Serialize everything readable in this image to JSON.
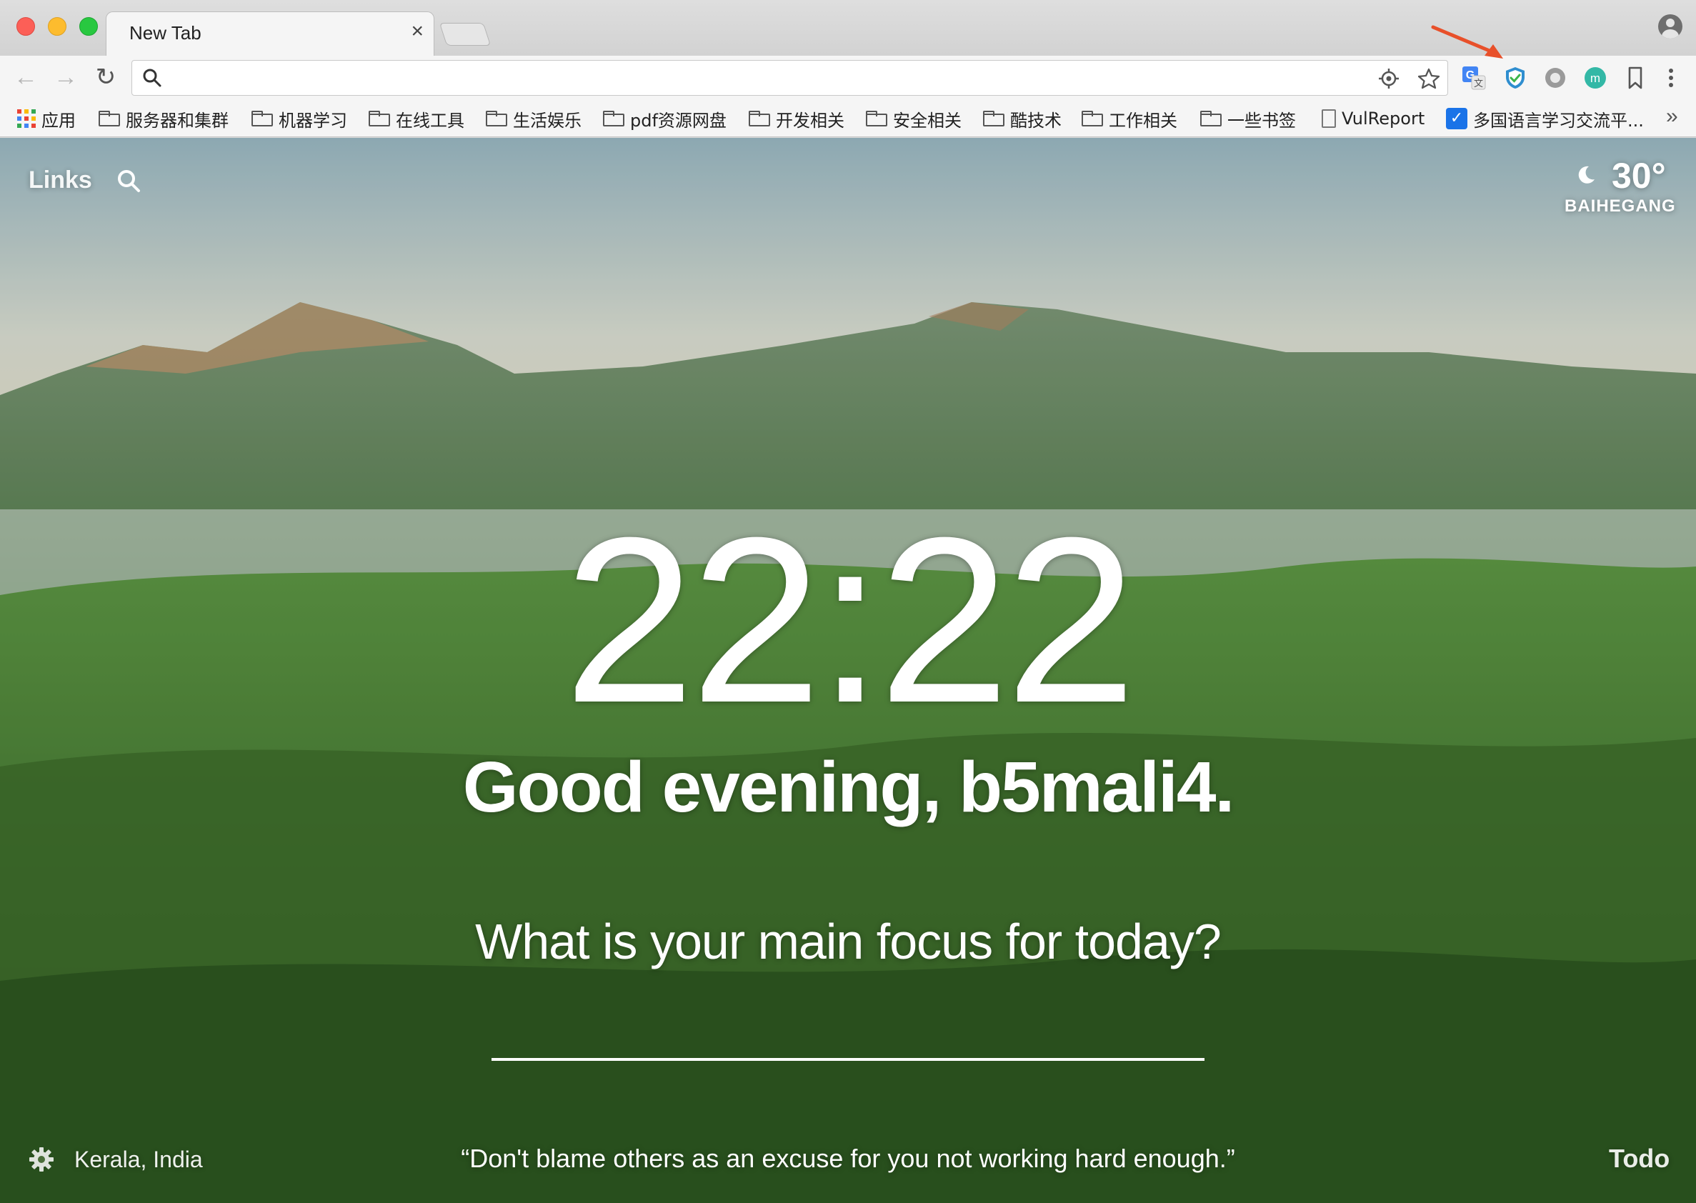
{
  "tab": {
    "title": "New Tab",
    "close": "×"
  },
  "toolbar": {
    "back": "←",
    "forward": "→",
    "reload": "↻",
    "omnibox_value": ""
  },
  "bookmarks": [
    {
      "label": "应用",
      "icon": "apps-icon"
    },
    {
      "label": "服务器和集群",
      "icon": "folder-icon"
    },
    {
      "label": "机器学习",
      "icon": "folder-icon"
    },
    {
      "label": "在线工具",
      "icon": "folder-icon"
    },
    {
      "label": "生活娱乐",
      "icon": "folder-icon"
    },
    {
      "label": "pdf资源网盘",
      "icon": "folder-icon"
    },
    {
      "label": "开发相关",
      "icon": "folder-icon"
    },
    {
      "label": "安全相关",
      "icon": "folder-icon"
    },
    {
      "label": "酷技术",
      "icon": "folder-icon"
    },
    {
      "label": "工作相关",
      "icon": "folder-icon"
    },
    {
      "label": "一些书签",
      "icon": "folder-icon"
    },
    {
      "label": "VulReport",
      "icon": "page-icon"
    },
    {
      "label": "多国语言学习交流平...",
      "icon": "check-icon"
    }
  ],
  "bookmarks_more": "»",
  "dashboard": {
    "links": "Links",
    "weather": {
      "temp": "30°",
      "location": "BAIHEGANG",
      "icon": "moon-icon"
    },
    "clock": "22:22",
    "greeting": "Good evening, b5mali4.",
    "focus_question": "What is your main focus for today?",
    "focus_value": "",
    "photo_location": "Kerala, India",
    "quote": "“Don't blame others as an excuse for you not working hard enough.”",
    "todo": "Todo"
  },
  "colors": {
    "annotation_arrow": "#e8502a",
    "traffic_red": "#fc5f57",
    "traffic_yellow": "#fdbc2e",
    "traffic_green": "#28c840"
  }
}
